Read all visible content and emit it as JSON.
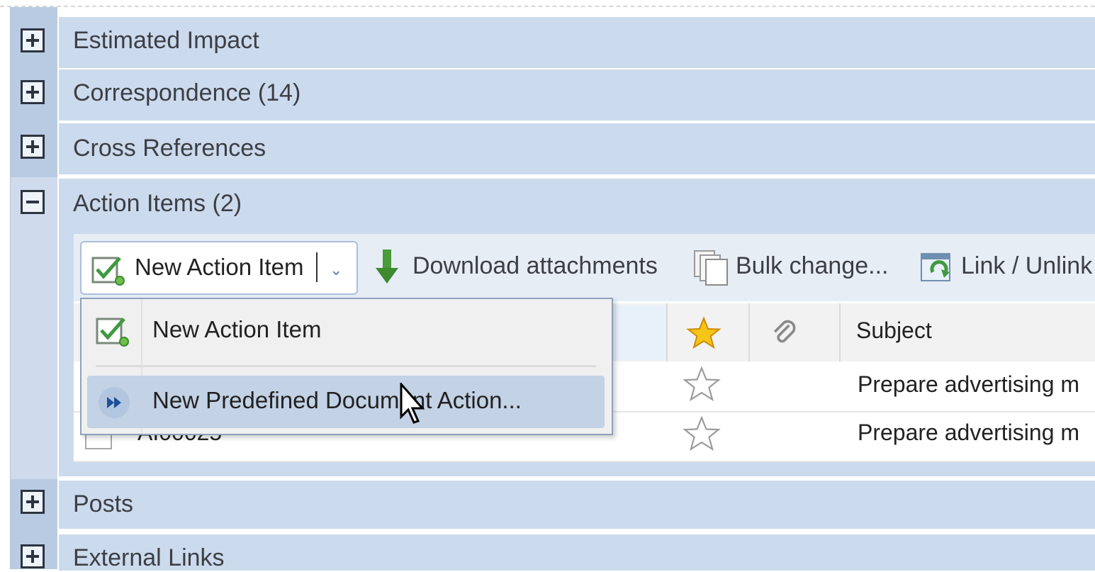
{
  "sections": [
    {
      "title": "Estimated Impact",
      "expanded": false
    },
    {
      "title": "Correspondence (14)",
      "expanded": false
    },
    {
      "title": "Cross References",
      "expanded": false
    },
    {
      "title": "Action Items (2)",
      "expanded": true
    },
    {
      "title": "Posts",
      "expanded": false
    },
    {
      "title": "External Links",
      "expanded": false
    }
  ],
  "toolbar": {
    "new_action_item": "New Action Item",
    "download_attachments": "Download attachments",
    "bulk_change": "Bulk change...",
    "link_unlink": "Link / Unlink"
  },
  "menu": {
    "items": [
      {
        "label": "New Action Item",
        "icon": "new-action-item-icon"
      },
      {
        "label": "New Predefined Document Action...",
        "icon": "fast-forward-icon",
        "highlighted": true
      }
    ]
  },
  "grid": {
    "columns": [
      "",
      "",
      "Subject"
    ],
    "rows": [
      {
        "id": "",
        "subject": "Prepare advertising m"
      },
      {
        "id": "AI00025",
        "subject": "Prepare advertising m"
      }
    ]
  },
  "colors": {
    "section_bg": "#ccdaee",
    "menu_highlight": "#c3d2e5",
    "star": "#f5c518"
  }
}
